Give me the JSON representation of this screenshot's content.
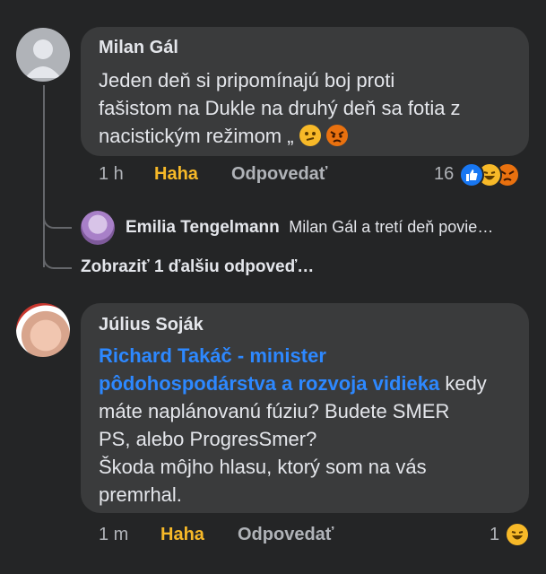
{
  "comments": [
    {
      "author": "Milan Gál",
      "text_lines": [
        "Jeden deň si pripomínajú boj proti",
        "fašistom na Dukle  na druhý deň sa fotia z",
        "nacistickým režimom „"
      ],
      "time": "1 h",
      "reaction_label": "Haha",
      "reply_label": "Odpovedať",
      "reaction_count": "16",
      "reactions": [
        "like-icon",
        "haha-icon",
        "angry-icon"
      ]
    },
    {
      "author": "Július Soják",
      "mention_lines": [
        "Richard Takáč - minister",
        "pôdohospodárstva a rozvoja vidieka"
      ],
      "text_after_mention": " kedy",
      "text_lines": [
        "máte naplánovanú fúziu? Budete SMER",
        "PS, alebo ProgresSmer?",
        "Škoda môjho hlasu, ktorý som na vás",
        "premrhal."
      ],
      "time": "1 m",
      "reaction_label": "Haha",
      "reply_label": "Odpovedať",
      "reaction_count": "1",
      "reactions": [
        "haha-icon"
      ]
    }
  ],
  "reply_preview": {
    "author": "Emilia Tengelmann",
    "text": "Milan Gál a tretí deň  povie…"
  },
  "more_replies": "Zobraziť 1 ďalšiu odpoveď…",
  "colors": {
    "background": "#242526",
    "bubble": "#3a3b3c",
    "mention": "#2d88ff",
    "haha": "#f7b928",
    "like_blue": "#1877f2",
    "angry_red": "#e9710f"
  }
}
